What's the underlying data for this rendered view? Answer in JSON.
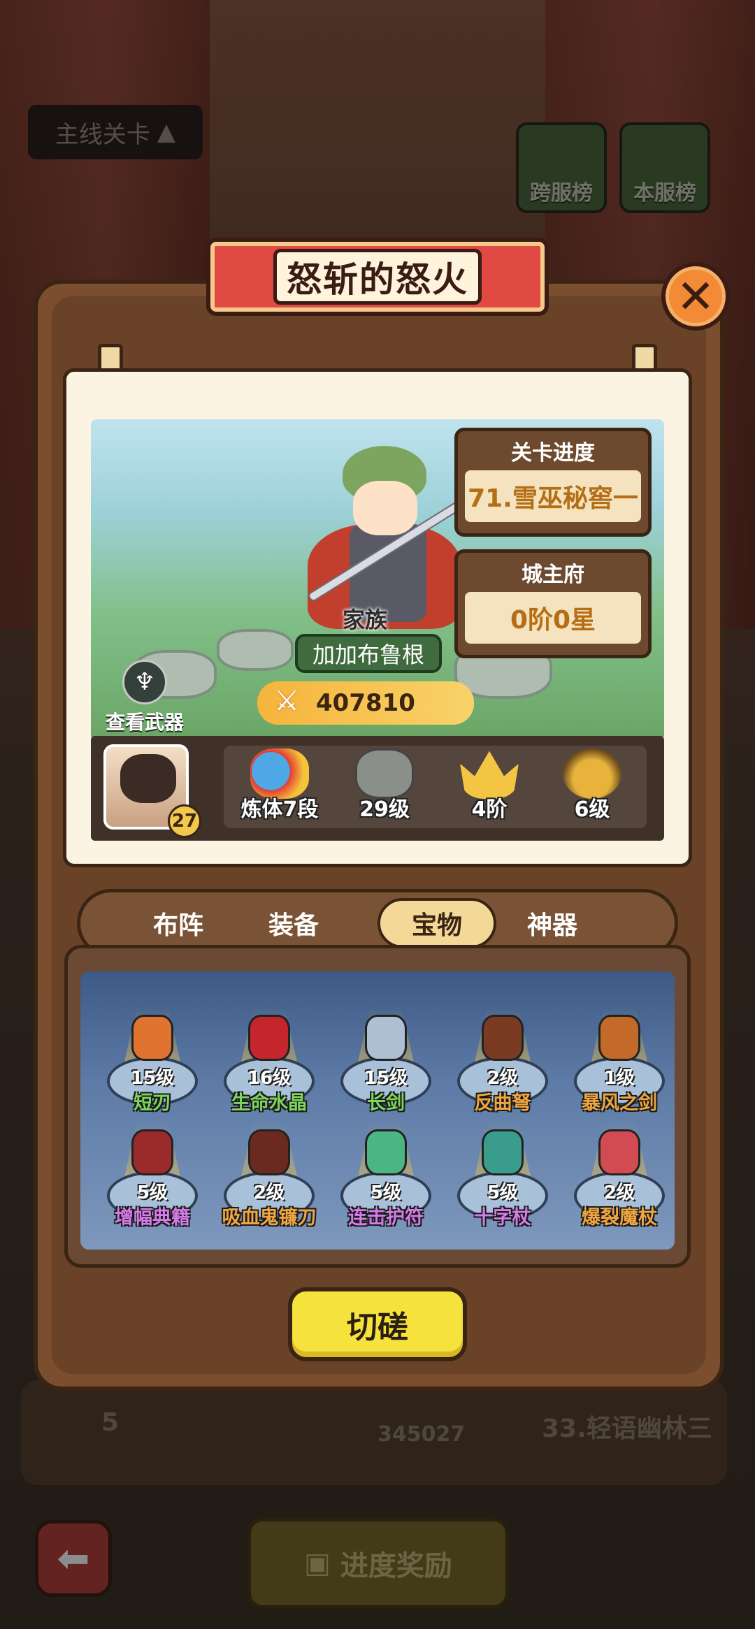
{
  "background": {
    "top_dropdown": "主线关卡",
    "rank_buttons": [
      "跨服榜",
      "本服榜"
    ],
    "bottom_row": {
      "rank": "5",
      "power": "345027",
      "stage": "33.轻语幽林三"
    },
    "back_icon": "back-arrow-icon",
    "reward_button": "进度奖励"
  },
  "dialog": {
    "title": "怒斩的怒火",
    "close_icon": "close-x-icon",
    "player": {
      "clan_label": "家族",
      "clan_name": "加加布鲁根",
      "power": "407810",
      "view_weapon": "查看武器",
      "avatar_level": "27"
    },
    "stage_progress": {
      "label": "关卡进度",
      "value": "71.雪巫秘窖一"
    },
    "city_hall": {
      "label": "城主府",
      "value": "0阶0星"
    },
    "stats": [
      "炼体7段",
      "29级",
      "4阶",
      "6级"
    ],
    "tabs": [
      "布阵",
      "装备",
      "宝物",
      "神器"
    ],
    "active_tab": "宝物",
    "treasures": [
      {
        "level": "15级",
        "name": "短刃",
        "color": "#7cd65c"
      },
      {
        "level": "16级",
        "name": "生命水晶",
        "color": "#7cd65c"
      },
      {
        "level": "15级",
        "name": "长剑",
        "color": "#7cd65c"
      },
      {
        "level": "2级",
        "name": "反曲弩",
        "color": "#f0a640"
      },
      {
        "level": "1级",
        "name": "暴风之剑",
        "color": "#f0a640"
      },
      {
        "level": "5级",
        "name": "增幅典籍",
        "color": "#d67ce8"
      },
      {
        "level": "2级",
        "name": "吸血鬼镰刀",
        "color": "#f0a640"
      },
      {
        "level": "5级",
        "name": "连击护符",
        "color": "#d67ce8"
      },
      {
        "level": "5级",
        "name": "十字杖",
        "color": "#d67ce8"
      },
      {
        "level": "2级",
        "name": "爆裂魔杖",
        "color": "#f0a640"
      }
    ],
    "spar_button": "切磋"
  }
}
